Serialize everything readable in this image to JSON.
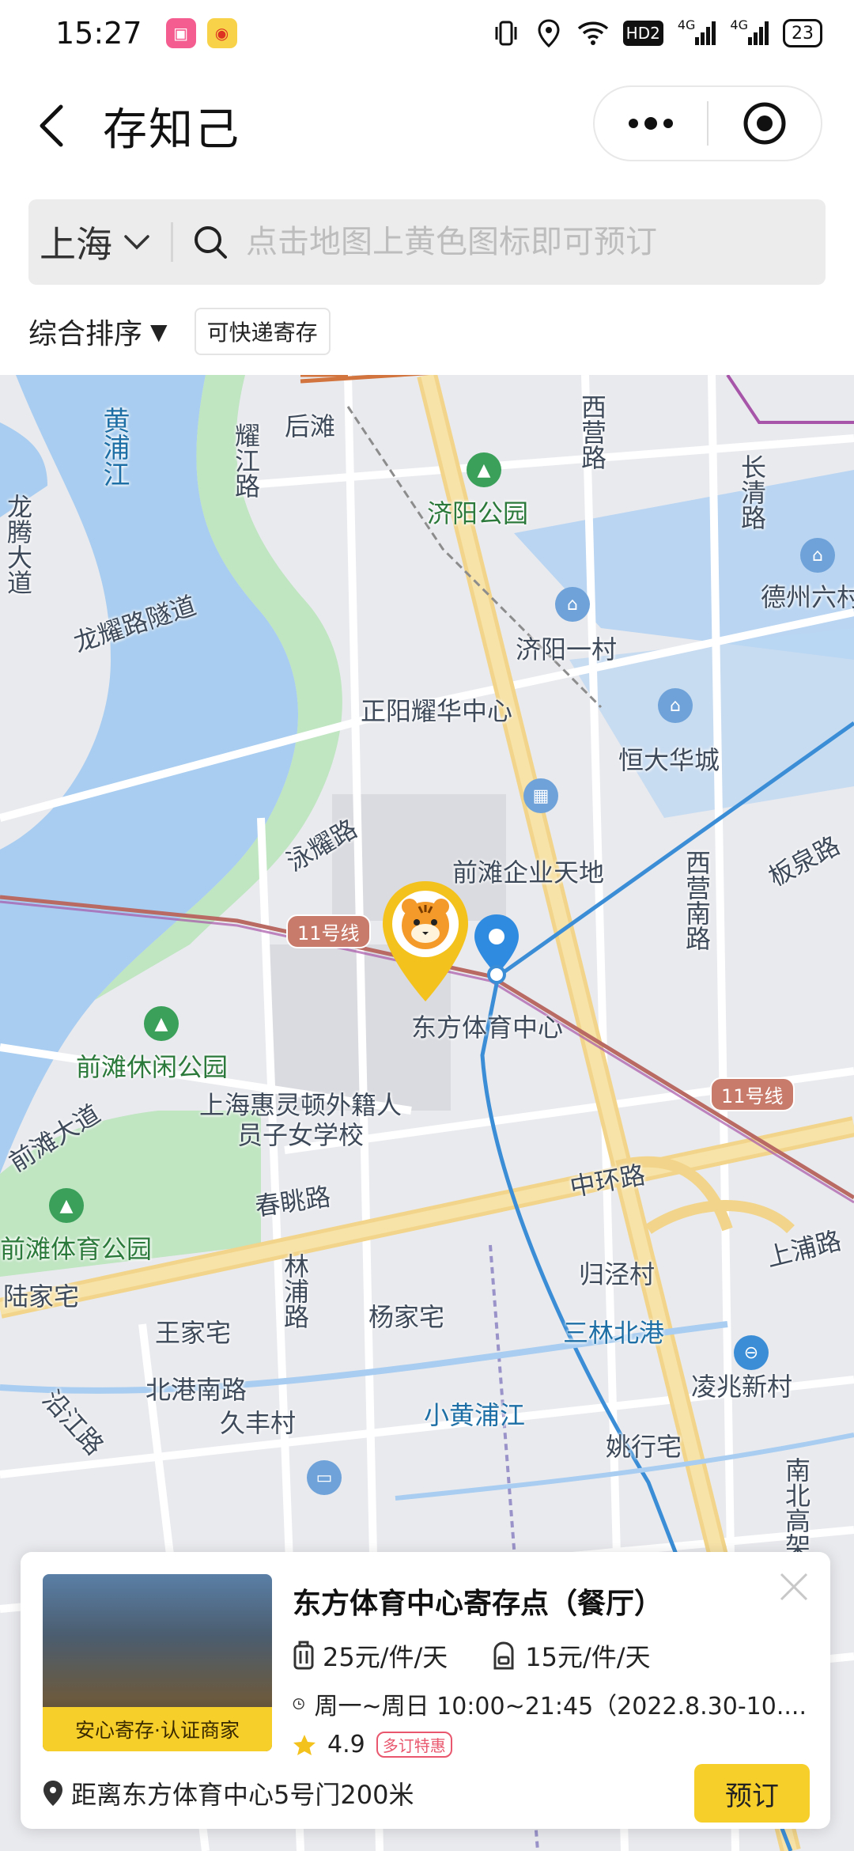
{
  "status_bar": {
    "time": "15:27",
    "apps": [
      "bilibili",
      "weibo"
    ],
    "hd_label": "HD2",
    "signal1": "4G",
    "signal2": "4G",
    "battery": "23"
  },
  "nav": {
    "title": "存知己"
  },
  "search": {
    "city": "上海",
    "placeholder": "点击地图上黄色图标即可预订"
  },
  "filters": {
    "sort_label": "综合排序",
    "sort_arrow": "▼",
    "chip_express": "可快递寄存"
  },
  "map": {
    "labels": {
      "houtan": "后滩",
      "huangpujiang": "黄浦江",
      "yaojianglu": "耀江路",
      "xiyinglu": "西营路",
      "changqinglu": "长清路",
      "jiyanggongyuan": "济阳公园",
      "dezhou": "德州六村",
      "longyaolusuidao": "龙耀路隧道",
      "jiyangyicun": "济阳一村",
      "zhengyang": "正阳耀华中心",
      "longteng": "龙腾大道",
      "hengda": "恒大华城",
      "yonglu": "泳耀路",
      "qiantanqiye": "前滩企业天地",
      "xiyingnanlu": "西营南路",
      "banquanlu": "板泉路",
      "dongfangtiyu": "东方体育中心",
      "qiantanxiuxian": "前滩休闲公园",
      "huiling": "上海惠灵顿外籍人员子女学校",
      "qiantandadao": "前滩大道",
      "chuntiaolu": "春眺路",
      "zhonghuanlu": "中环路",
      "shangpulu": "上浦路",
      "qiantantiyu": "前滩体育公园",
      "lujiazhai": "陆家宅",
      "linpulu": "林浦路",
      "guijingcun": "归泾村",
      "yangjiazhai": "杨家宅",
      "wangjiazhai": "王家宅",
      "sanlinbeigang": "三林北港",
      "beigangnanlu": "北港南路",
      "lingzhaoxincun": "凌兆新村",
      "yanjianglu": "沿江路",
      "jiufengcun": "久丰村",
      "xiaohuangpujiang": "小黄浦江",
      "yaohangzhai": "姚行宅",
      "nanbeigao": "南北高架",
      "line11a": "11号线",
      "line11b": "11号线"
    }
  },
  "store_card": {
    "thumb_badge": "安心寄存·认证商家",
    "title": "东方体育中心寄存点（餐厅）",
    "price_large": "25元/件/天",
    "price_small": "15元/件/天",
    "hours": "周一~周日 10:00~21:45（2022.8.30-10....",
    "rating": "4.9",
    "promo": "多订特惠",
    "distance": "距离东方体育中心5号门200米",
    "book_label": "预订"
  }
}
